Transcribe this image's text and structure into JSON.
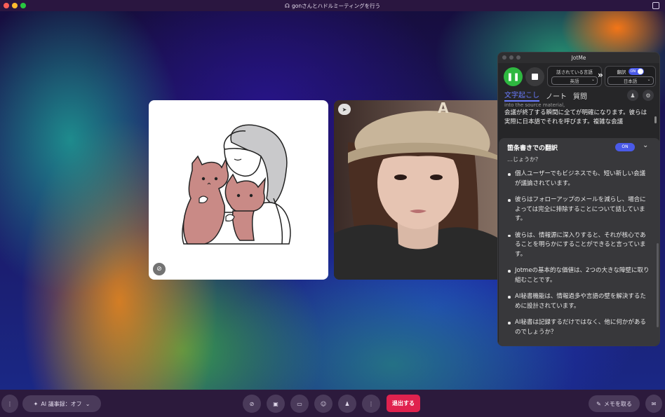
{
  "window": {
    "title": "gonさんとハドルミーティングを行う",
    "traffic_lights": [
      "#ff5f57",
      "#febc2e",
      "#28c840"
    ]
  },
  "participants": [
    {
      "name": "illustration-avatar",
      "muted": true
    },
    {
      "name": "camera-participant",
      "pinned": true
    }
  ],
  "jotme": {
    "title": "JotMe",
    "source_lang_label": "話されている言語",
    "source_lang_value": "英語",
    "translate_label": "翻訳",
    "translate_toggle": "ON",
    "target_lang_value": "日本語",
    "tabs": [
      "文字起こし",
      "ノート",
      "質問"
    ],
    "transcript_faded": "into the source material,",
    "transcript_body": "会議が終了する瞬間に全てが明確になります。彼らは実際に日本語でそれを呼びます。複雑な会議",
    "summary_title": "箇条書きでの翻訳",
    "summary_toggle": "ON",
    "summary_cut": "…じょうか？",
    "summary_items": [
      "個人ユーザーでもビジネスでも、短い新しい会議が議論されています。",
      "彼らはフォローアップのメールを減らし、場合によっては完全に排除することについて話しています。",
      "彼らは、情報源に深入りすると、それが核心であることを明らかにすることができると言っています。",
      "Jotmeの基本的な価値は、2つの大きな障壁に取り組むことです。",
      "AI秘書機能は、情報過多や言語の壁を解決するために設計されています。",
      "AI秘書は記録するだけではなく、他に何かがあるのでしょうか？"
    ],
    "accent": "#4a5ae8",
    "active_tab_color": "#6a7cff",
    "record_color": "#2eb840"
  },
  "bottombar": {
    "ai_notes_label": "AI 議事録：オフ",
    "leave_label": "退出する",
    "take_notes_label": "メモを取る",
    "leave_color": "#e0224e"
  }
}
